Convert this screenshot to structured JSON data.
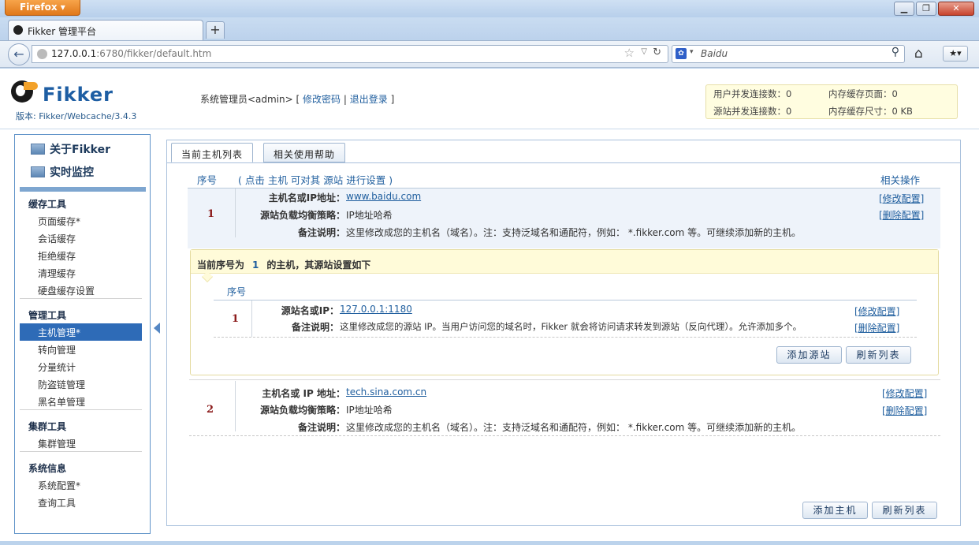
{
  "browser": {
    "app_button": "Firefox",
    "tab_title": "Fikker 管理平台",
    "url_host": "127.0.0.1",
    "url_rest": ":6780/fikker/default.htm",
    "search_engine": "Baidu"
  },
  "header": {
    "logo": "Fikker",
    "version": "版本: Fikker/Webcache/3.4.3",
    "admin_text": "系统管理员<admin> [",
    "change_password": "修改密码",
    "separator": "|",
    "logout": "退出登录",
    "close_bracket": "]",
    "stats": {
      "user_conn_label": "用户并发连接数：0",
      "mem_pages_label": "内存缓存页面：0",
      "origin_conn_label": "源站并发连接数：0",
      "mem_size_label": "内存缓存尺寸：0 KB"
    }
  },
  "sidebar": {
    "about": "关于Fikker",
    "monitor": "实时监控",
    "sections": [
      {
        "title": "缓存工具",
        "items": [
          "页面缓存*",
          "会话缓存",
          "拒绝缓存",
          "清理缓存",
          "硬盘缓存设置"
        ]
      },
      {
        "title": "管理工具",
        "items": [
          "主机管理*",
          "转向管理",
          "分量统计",
          "防盗链管理",
          "黑名单管理"
        ]
      },
      {
        "title": "集群工具",
        "items": [
          "集群管理"
        ]
      },
      {
        "title": "系统信息",
        "items": [
          "系统配置*",
          "查询工具"
        ]
      }
    ]
  },
  "main": {
    "tabs": [
      "当前主机列表",
      "相关使用帮助"
    ],
    "col_index": "序号",
    "col_hint": "( 点击 主机 可对其 源站 进行设置 )",
    "col_ops": "相关操作",
    "hosts": [
      {
        "index": "1",
        "host_label": "主机名或IP地址：",
        "host": "www.baidu.com",
        "policy_label": "源站负载均衡策略：",
        "policy": "IP地址哈希",
        "note_label": "备注说明：",
        "note": "这里修改成您的主机名（域名）。注：支持泛域名和通配符，例如： *.fikker.com 等。可继续添加新的主机。",
        "edit": "[修改配置]",
        "delete": "[删除配置]"
      },
      {
        "index": "2",
        "host_label": "主机名或 IP 地址：",
        "host": "tech.sina.com.cn",
        "policy_label": "源站负载均衡策略：",
        "policy": "IP地址哈希",
        "note_label": "备注说明：",
        "note": "这里修改成您的主机名（域名）。注：支持泛域名和通配符，例如： *.fikker.com 等。可继续添加新的主机。",
        "edit": "[修改配置]",
        "delete": "[删除配置]"
      }
    ],
    "origin_panel": {
      "title_prefix": "当前序号为",
      "title_index": "1",
      "title_suffix": "的主机，其源站设置如下",
      "col_index": "序号",
      "origins": [
        {
          "index": "1",
          "origin_label": "源站名或IP：",
          "origin": "127.0.0.1:1180",
          "note_label": "备注说明：",
          "note": "这里修改成您的源站 IP。当用户访问您的域名时，Fikker 就会将访问请求转发到源站（反向代理）。允许添加多个。",
          "edit": "[修改配置]",
          "delete": "[删除配置]"
        }
      ],
      "add_button": "添加源站",
      "refresh_button": "刷新列表"
    },
    "add_host_button": "添加主机",
    "refresh_button": "刷新列表"
  }
}
